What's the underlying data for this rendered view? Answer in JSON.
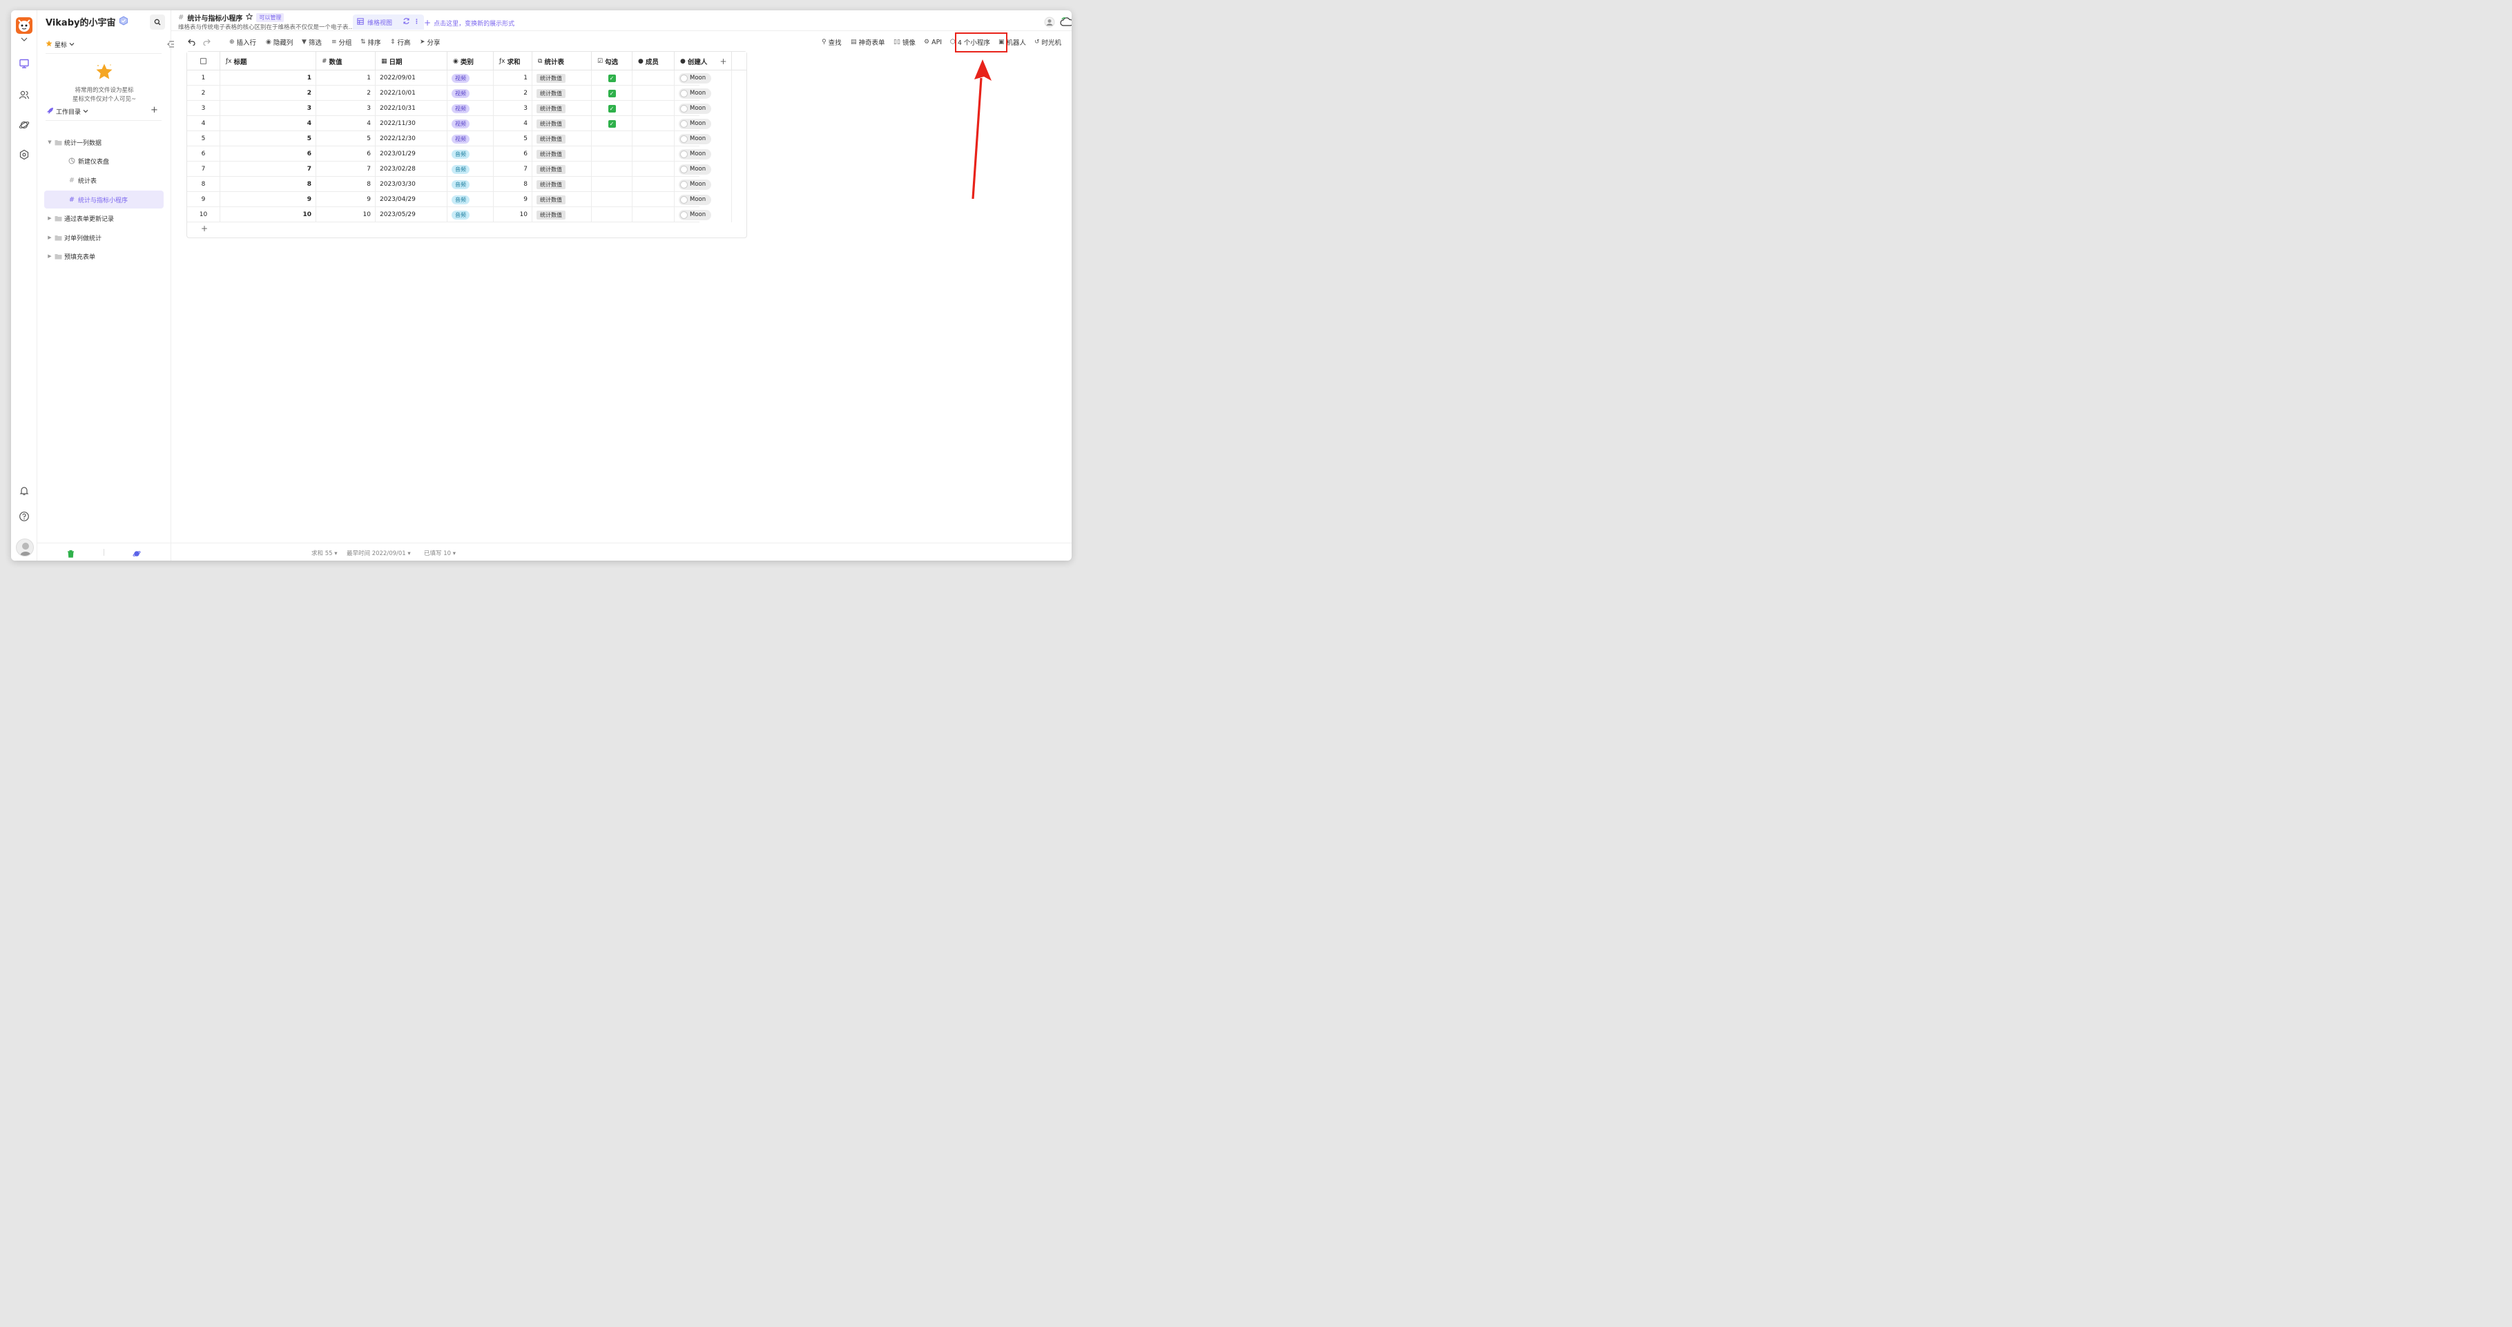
{
  "workspace": {
    "name": "Vikaby的小宇宙"
  },
  "sidebar": {
    "star_section": "星标",
    "star_empty_line1": "将常用的文件设为星标",
    "star_empty_line2": "星标文件仅对个人可见~",
    "work_dir": "工作目录",
    "tree": [
      {
        "label": "统计一列数据",
        "type": "folder",
        "expanded": true,
        "level": 0
      },
      {
        "label": "新建仪表盘",
        "type": "dashboard",
        "level": 1
      },
      {
        "label": "统计表",
        "type": "sheet",
        "level": 1
      },
      {
        "label": "统计与指标小程序",
        "type": "sheet",
        "level": 1,
        "active": true
      },
      {
        "label": "通过表单更新记录",
        "type": "folder",
        "level": 0
      },
      {
        "label": "对单列做统计",
        "type": "folder",
        "level": 0
      },
      {
        "label": "预填充表单",
        "type": "folder",
        "level": 0
      }
    ]
  },
  "header": {
    "title": "统计与指标小程序",
    "permission": "可以管理",
    "description": "维格表与传统电子表格的核心区别在于维格表不仅仅是一个电子表...",
    "view_tab": "维格视图",
    "add_view": "点击这里，变换新的展示形式"
  },
  "toolbar": {
    "insert_row": "插入行",
    "hide_cols": "隐藏列",
    "filter": "筛选",
    "group": "分组",
    "sort": "排序",
    "row_height": "行高",
    "share": "分享",
    "find": "查找",
    "form": "神奇表单",
    "mirror": "镜像",
    "api": "API",
    "widgets": "4 个小程序",
    "robot": "机器人",
    "timemachine": "时光机"
  },
  "grid": {
    "columns": [
      "标题",
      "数值",
      "日期",
      "类别",
      "求和",
      "统计表",
      "勾选",
      "成员",
      "创建人"
    ],
    "rows": [
      {
        "n": "1",
        "title": "1",
        "value": "1",
        "date": "2022/09/01",
        "cat": "视频",
        "sum": "1",
        "link": "统计数值",
        "check": true,
        "creator": "Moon"
      },
      {
        "n": "2",
        "title": "2",
        "value": "2",
        "date": "2022/10/01",
        "cat": "视频",
        "sum": "2",
        "link": "统计数值",
        "check": true,
        "creator": "Moon"
      },
      {
        "n": "3",
        "title": "3",
        "value": "3",
        "date": "2022/10/31",
        "cat": "视频",
        "sum": "3",
        "link": "统计数值",
        "check": true,
        "creator": "Moon"
      },
      {
        "n": "4",
        "title": "4",
        "value": "4",
        "date": "2022/11/30",
        "cat": "视频",
        "sum": "4",
        "link": "统计数值",
        "check": true,
        "creator": "Moon"
      },
      {
        "n": "5",
        "title": "5",
        "value": "5",
        "date": "2022/12/30",
        "cat": "视频",
        "sum": "5",
        "link": "统计数值",
        "check": false,
        "creator": "Moon"
      },
      {
        "n": "6",
        "title": "6",
        "value": "6",
        "date": "2023/01/29",
        "cat": "音频",
        "sum": "6",
        "link": "统计数值",
        "check": false,
        "creator": "Moon"
      },
      {
        "n": "7",
        "title": "7",
        "value": "7",
        "date": "2023/02/28",
        "cat": "音频",
        "sum": "7",
        "link": "统计数值",
        "check": false,
        "creator": "Moon"
      },
      {
        "n": "8",
        "title": "8",
        "value": "8",
        "date": "2023/03/30",
        "cat": "音频",
        "sum": "8",
        "link": "统计数值",
        "check": false,
        "creator": "Moon"
      },
      {
        "n": "9",
        "title": "9",
        "value": "9",
        "date": "2023/04/29",
        "cat": "音频",
        "sum": "9",
        "link": "统计数值",
        "check": false,
        "creator": "Moon"
      },
      {
        "n": "10",
        "title": "10",
        "value": "10",
        "date": "2023/05/29",
        "cat": "音频",
        "sum": "10",
        "link": "统计数值",
        "check": false,
        "creator": "Moon"
      }
    ]
  },
  "status": {
    "sum": "求和 55",
    "earliest": "最早时间 2022/09/01",
    "filled": "已填写 10"
  },
  "colors": {
    "accent": "#7b67ee",
    "highlight": "#e8231a",
    "check_green": "#2fb14b"
  }
}
